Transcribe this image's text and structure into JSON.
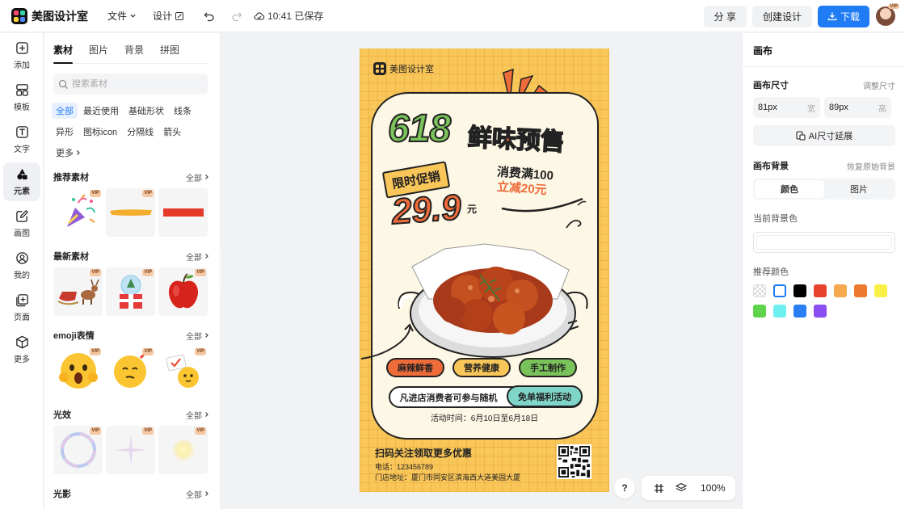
{
  "app": {
    "name": "美图设计室"
  },
  "topbar": {
    "file_label": "文件",
    "design_label": "设计",
    "save_status": "10:41 已保存",
    "share_label": "分 享",
    "create_label": "创建设计",
    "download_label": "下载",
    "avatar_badge": "VIP"
  },
  "nav": [
    {
      "label": "添加",
      "icon": "plus-square-icon"
    },
    {
      "label": "模板",
      "icon": "template-grid-icon"
    },
    {
      "label": "文字",
      "icon": "text-icon"
    },
    {
      "label": "元素",
      "icon": "shapes-icon"
    },
    {
      "label": "画图",
      "icon": "pen-edit-icon"
    },
    {
      "label": "我的",
      "icon": "user-icon"
    },
    {
      "label": "页面",
      "icon": "page-add-icon"
    },
    {
      "label": "更多",
      "icon": "cube-icon"
    }
  ],
  "panel": {
    "tabs": [
      "素材",
      "图片",
      "背景",
      "拼图"
    ],
    "search_placeholder": "搜索素材",
    "chips": [
      "全部",
      "最近使用",
      "基础形状",
      "线条",
      "异形",
      "图标icon",
      "分隔线",
      "箭头",
      "更多"
    ],
    "all_label": "全部",
    "vip": "VIP",
    "sections": [
      {
        "title": "推荐素材"
      },
      {
        "title": "最新素材"
      },
      {
        "title": "emoji表情"
      },
      {
        "title": "光效"
      },
      {
        "title": "光影"
      }
    ]
  },
  "poster": {
    "logo": "美图设计室",
    "headline_num": "618",
    "headline_text": "鲜味预售",
    "flash_sale": "限时促销",
    "price": "29.9",
    "price_unit": "元",
    "offer_line1": "消费满100",
    "offer_line2": "立减20元",
    "tags": [
      "麻辣鲜香",
      "营养健康",
      "手工制作"
    ],
    "activity_text": "凡进店消费者可参与随机",
    "activity_badge": "免单福利活动",
    "activity_time": "活动时间：6月10日至6月18日",
    "scan_text": "扫码关注领取更多优惠",
    "phone": "电话：123456789",
    "address": "门店地址：厦门市同安区滨海西大道美园大厦"
  },
  "bottom_tools": {
    "help": "?",
    "zoom": "100%"
  },
  "right_panel": {
    "title": "画布",
    "size_label": "画布尺寸",
    "size_adjust": "调整尺寸",
    "width_value": "81px",
    "width_unit": "宽",
    "height_value": "89px",
    "height_unit": "高",
    "ai_extend": "AI尺寸延展",
    "bg_label": "画布背景",
    "bg_reset": "恢复原始背景",
    "bg_tabs": [
      "颜色",
      "图片"
    ],
    "current_bg": "当前背景色",
    "recommended": "推荐颜色"
  },
  "colors": {
    "accent": "#1f7cf5",
    "poster_bg": "#f9c659",
    "title_green": "#7ac25a",
    "title_orange": "#ee6b3a",
    "swatches": [
      "transparent",
      "#ffffff",
      "#000000",
      "#e8432c",
      "#f6a94f",
      "#ee7a30",
      "#f8f046",
      "#5fd34c",
      "#6ff0f0",
      "#2a7ef3",
      "#8a4ef2"
    ]
  }
}
